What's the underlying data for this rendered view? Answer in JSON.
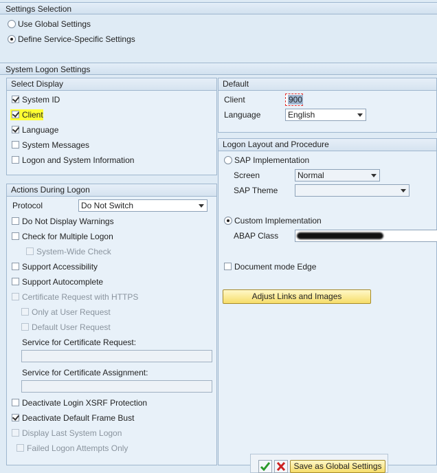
{
  "settings_selection": {
    "title": "Settings Selection",
    "use_global": "Use Global Settings",
    "define_specific": "Define Service-Specific Settings"
  },
  "system_logon": {
    "title": "System Logon Settings",
    "select_display": {
      "title": "Select Display",
      "items": [
        "System ID",
        "Client",
        "Language",
        "System Messages",
        "Logon and System Information"
      ]
    },
    "default": {
      "title": "Default",
      "client_label": "Client",
      "client_value": "900",
      "language_label": "Language",
      "language_value": "English"
    },
    "actions": {
      "title": "Actions During Logon",
      "protocol_label": "Protocol",
      "protocol_value": "Do Not Switch",
      "do_not_display_warnings": "Do Not Display Warnings",
      "check_multiple_logon": "Check for Multiple Logon",
      "system_wide_check": "System-Wide Check",
      "support_accessibility": "Support Accessibility",
      "support_autocomplete": "Support Autocomplete",
      "cert_request_https": "Certificate Request with HTTPS",
      "only_at_user_request": "Only at User Request",
      "default_user_request": "Default User Request",
      "service_cert_request": "Service for Certificate Request:",
      "service_cert_assignment": "Service for Certificate Assignment:",
      "deactivate_xsrf": "Deactivate Login XSRF Protection",
      "deactivate_frame_bust": "Deactivate Default Frame Bust",
      "display_last_logon": "Display Last System Logon",
      "failed_logon_attempts": "Failed Logon Attempts Only"
    },
    "layout": {
      "title": "Logon Layout and Procedure",
      "sap_impl": "SAP Implementation",
      "screen_label": "Screen",
      "screen_value": "Normal",
      "theme_label": "SAP Theme",
      "theme_value": "",
      "custom_impl": "Custom Implementation",
      "abap_class_label": "ABAP Class",
      "document_mode": "Document mode Edge",
      "adjust_button": "Adjust Links and Images"
    }
  },
  "footer": {
    "save_global": "Save as Global Settings"
  },
  "colors": {
    "accent_highlight": "#ffff33",
    "button_yellow": "#f6dd6a",
    "ok_green": "#2a9a2a",
    "cancel_red": "#cc2222"
  }
}
